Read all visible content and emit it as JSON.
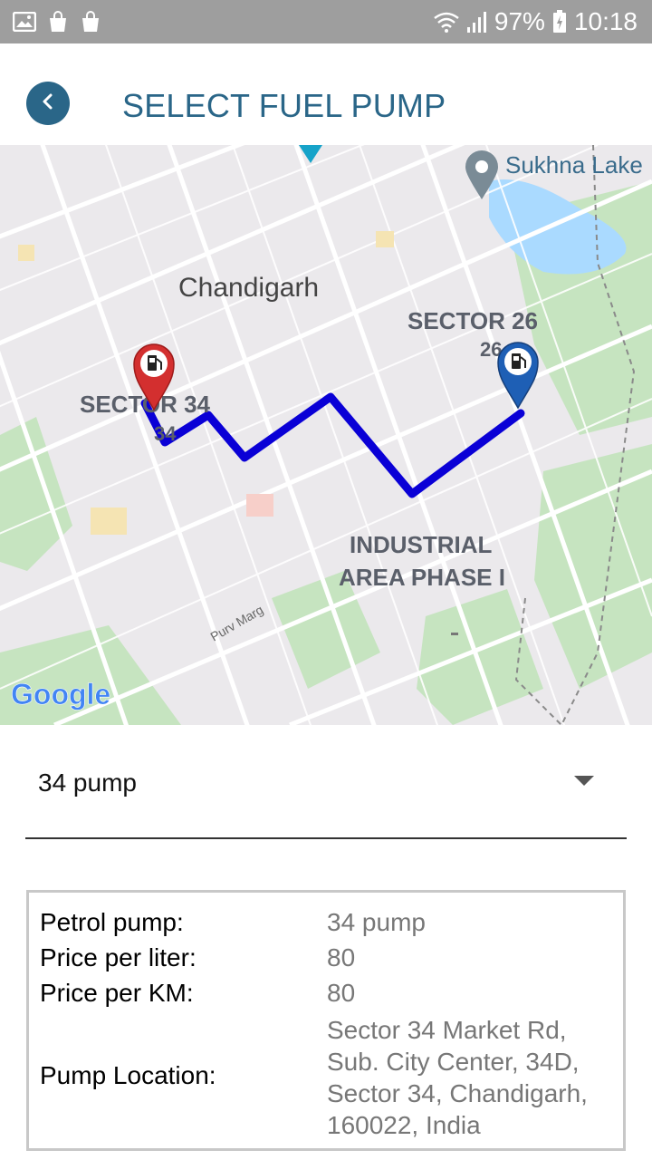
{
  "status_bar": {
    "battery": "97%",
    "time": "10:18",
    "left_icons": [
      "image-icon",
      "shopping-bag-icon",
      "shopping-bag-icon"
    ],
    "right_icons": [
      "wifi-icon",
      "signal-icon",
      "battery-charging-icon"
    ]
  },
  "header": {
    "title": "SELECT FUEL PUMP",
    "back_icon": "back-arrow-icon"
  },
  "map": {
    "labels": {
      "lake": "Sukhna Lake",
      "city": "Chandigarh",
      "sector26": "SECTOR 26",
      "sector26_num": "26",
      "sector34": "SECTOR 34",
      "sector34_num": "34",
      "industrial_line1": "INDUSTRIAL",
      "industrial_line2": "AREA PHASE I",
      "road": "Purv Marg",
      "logo": "Google"
    },
    "colors": {
      "route": "#0a00d6",
      "start_marker": "#d32f2f",
      "end_marker": "#1e5fb5"
    }
  },
  "dropdown": {
    "selected": "34 pump"
  },
  "details": {
    "petrol_pump_label": "Petrol pump:",
    "petrol_pump_value": "34 pump",
    "price_liter_label": "Price per liter:",
    "price_liter_value": "80",
    "price_km_label": "Price per KM:",
    "price_km_value": "80",
    "location_label": "Pump Location:",
    "location_value": "Sector 34 Market Rd, Sub. City Center, 34D, Sector 34, Chandigarh, 160022, India"
  }
}
